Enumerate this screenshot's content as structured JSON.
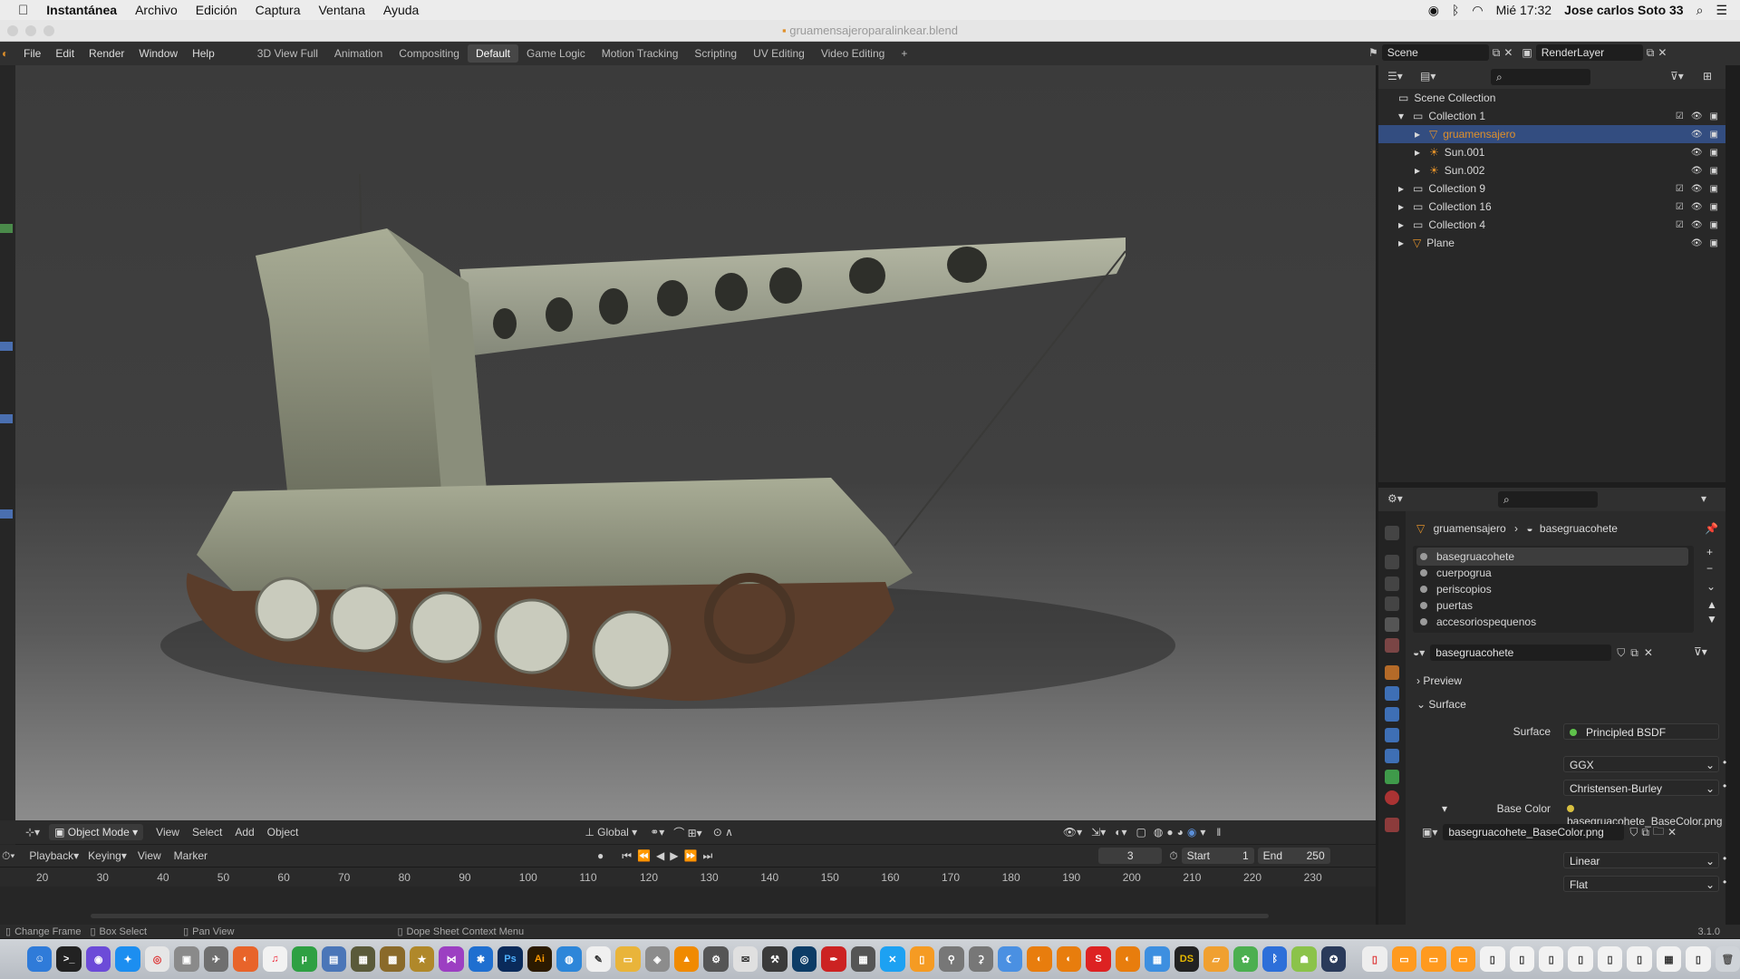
{
  "mac_menubar": {
    "apple": "",
    "app_name": "Instantánea",
    "menus": [
      "Archivo",
      "Edición",
      "Captura",
      "Ventana",
      "Ayuda"
    ],
    "clock": "Mié 17:32",
    "user": "Jose carlos Soto 33"
  },
  "window": {
    "title": "gruamensajeroparalinkear.blend"
  },
  "blender_menu": [
    "File",
    "Edit",
    "Render",
    "Window",
    "Help"
  ],
  "workspaces": [
    "3D View Full",
    "Animation",
    "Compositing",
    "Default",
    "Game Logic",
    "Motion Tracking",
    "Scripting",
    "UV Editing",
    "Video Editing"
  ],
  "active_workspace": "Default",
  "add_workspace": "+",
  "scene": {
    "name": "Scene",
    "render_layer": "RenderLayer"
  },
  "viewport_header": {
    "mode": "Object Mode",
    "menus": [
      "View",
      "Select",
      "Add",
      "Object"
    ],
    "orientation": "Global"
  },
  "timeline": {
    "menus": [
      "Playback",
      "Keying",
      "View",
      "Marker"
    ],
    "current_frame": "3",
    "start_label": "Start",
    "start": "1",
    "end_label": "End",
    "end": "250",
    "ruler": [
      "20",
      "30",
      "40",
      "50",
      "60",
      "70",
      "80",
      "90",
      "100",
      "110",
      "120",
      "130",
      "140",
      "150",
      "160",
      "170",
      "180",
      "190",
      "200",
      "210",
      "220",
      "230"
    ]
  },
  "status_bar": {
    "items": [
      "Change Frame",
      "Box Select",
      "Pan View",
      "Dope Sheet Context Menu"
    ],
    "version": "3.1.0"
  },
  "outliner": {
    "root": "Scene Collection",
    "rows": [
      {
        "label": "Collection 1",
        "depth": 1,
        "expanded": true
      },
      {
        "label": "gruamensajero",
        "depth": 2,
        "selected": true
      },
      {
        "label": "Sun.001",
        "depth": 2
      },
      {
        "label": "Sun.002",
        "depth": 2
      },
      {
        "label": "Collection 9",
        "depth": 1
      },
      {
        "label": "Collection 16",
        "depth": 1
      },
      {
        "label": "Collection 4",
        "depth": 1
      },
      {
        "label": "Plane",
        "depth": 1
      }
    ]
  },
  "properties": {
    "breadcrumb_object": "gruamensajero",
    "breadcrumb_material": "basegruacohete",
    "material_slots": [
      "basegruacohete",
      "cuerpogrua",
      "periscopios",
      "puertas",
      "accesoriospequenos"
    ],
    "active_material": "basegruacohete",
    "sections": {
      "preview": "Preview",
      "surface": "Surface"
    },
    "surface_label": "Surface",
    "surface_value": "Principled BSDF",
    "distribution": "GGX",
    "subsurface_method": "Christensen-Burley",
    "base_color_label": "Base Color",
    "base_color_value": "basegruacohete_BaseColor.png",
    "image_name": "basegruacohete_BaseColor.png",
    "interpolation": "Linear",
    "projection": "Flat"
  },
  "colors": {
    "selection": "#334d80",
    "accent_orange": "#e0902a",
    "shader_green": "#5fc24b",
    "texture_yellow": "#d8c040"
  }
}
